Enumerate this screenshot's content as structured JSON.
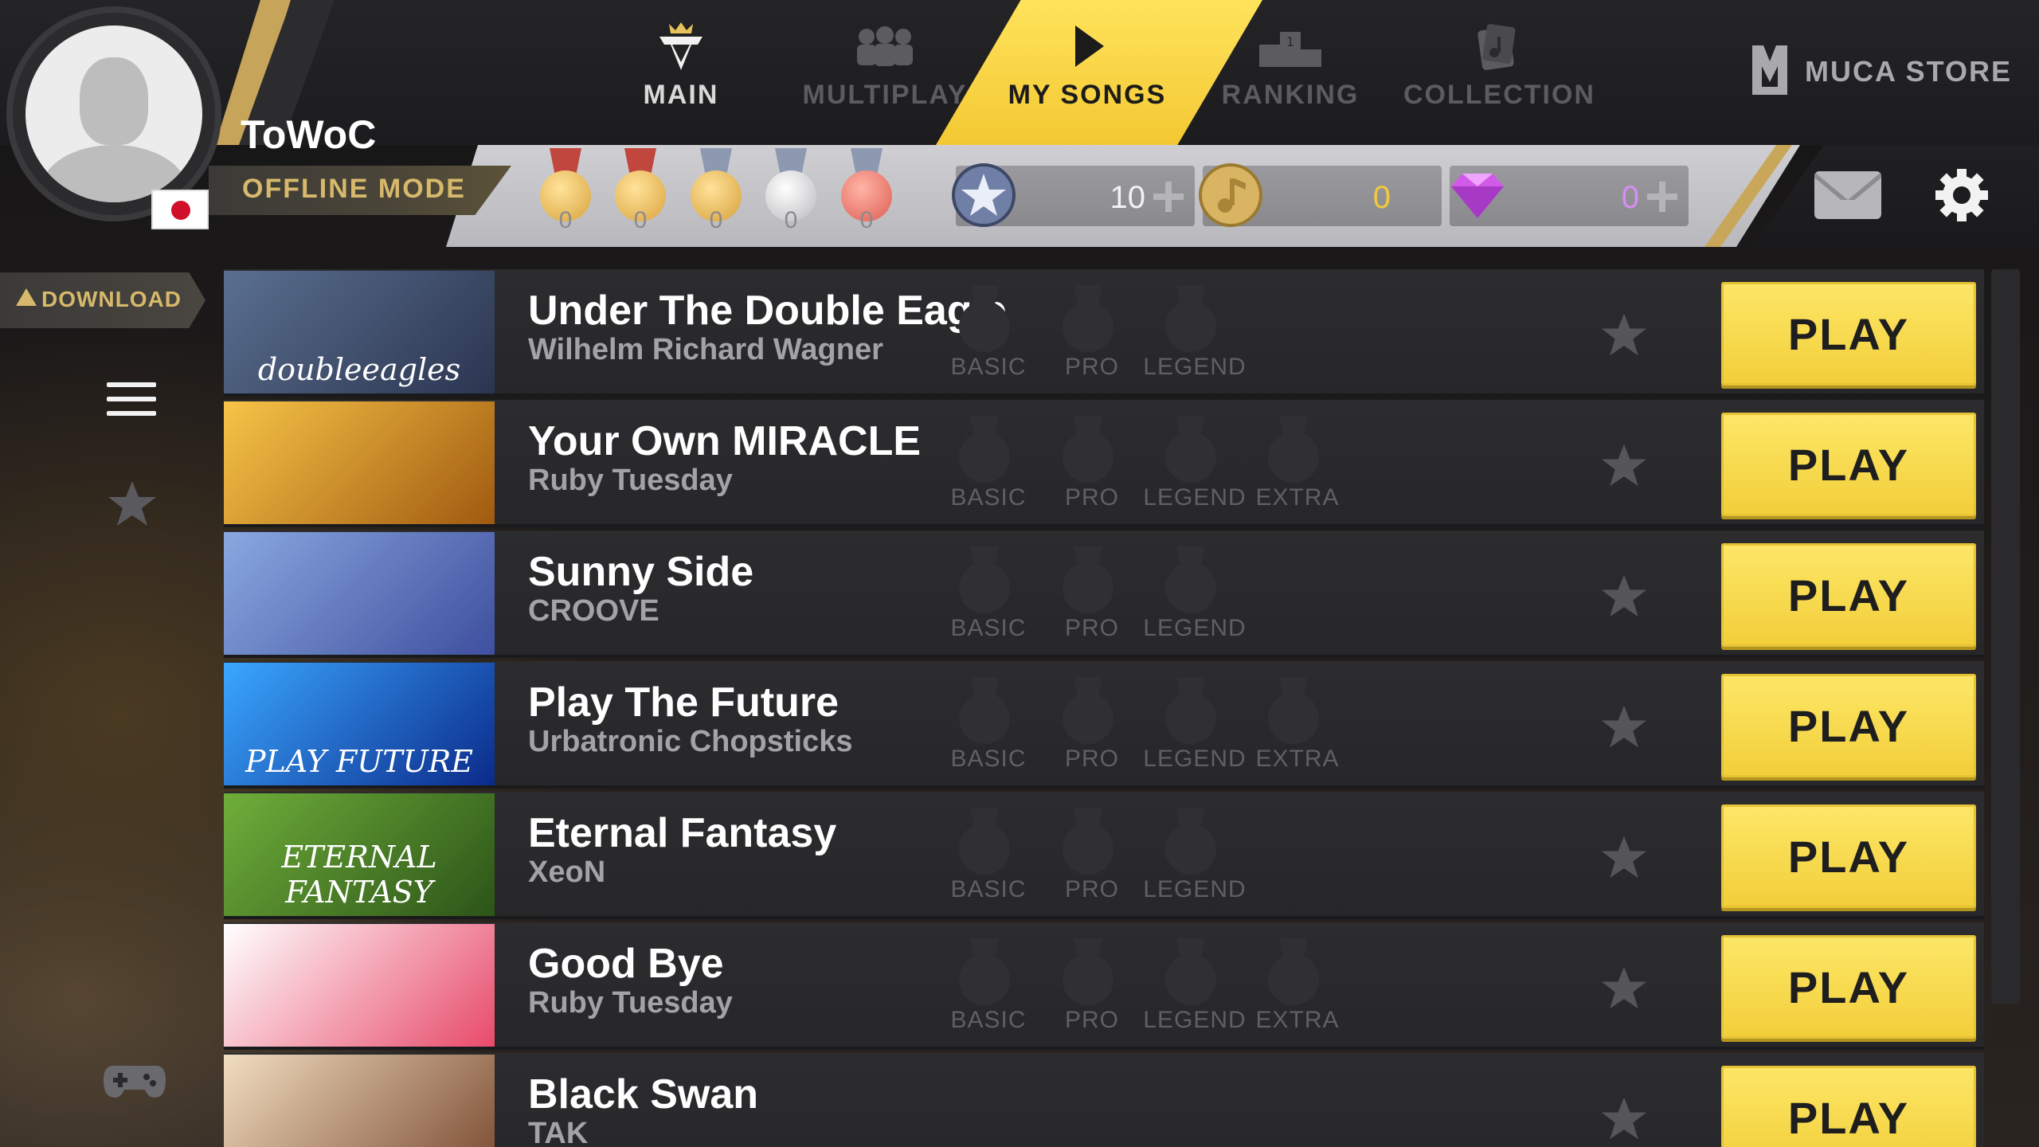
{
  "profile": {
    "username": "ToWoC",
    "mode": "OFFLINE MODE",
    "flag": "japan-flag"
  },
  "nav": [
    {
      "label": "MAIN",
      "icon": "crown-logo-icon",
      "state": "normal"
    },
    {
      "label": "MULTIPLAY",
      "icon": "group-icon",
      "state": "dim"
    },
    {
      "label": "MY SONGS",
      "icon": "play-icon",
      "state": "active"
    },
    {
      "label": "RANKING",
      "icon": "podium-icon",
      "state": "dim"
    },
    {
      "label": "COLLECTION",
      "icon": "music-card-icon",
      "state": "dim"
    }
  ],
  "store": {
    "label": "MUCA STORE",
    "icon": "muca-logo-icon"
  },
  "medals": [
    {
      "count": "0",
      "color": "#e8b24a"
    },
    {
      "count": "0",
      "color": "#e8b24a"
    },
    {
      "count": "0",
      "color": "#e0aa44"
    },
    {
      "count": "0",
      "color": "#cfcfd3"
    },
    {
      "count": "0",
      "color": "#e2736a"
    }
  ],
  "currencies": [
    {
      "name": "star",
      "icon": "star-coin-icon",
      "value": "10"
    },
    {
      "name": "music-coin",
      "icon": "note-coin-icon",
      "value": "0"
    },
    {
      "name": "gem",
      "icon": "diamond-icon",
      "value": "0"
    }
  ],
  "sidebar": {
    "download_label": "DOWNLOAD"
  },
  "play_label": "PLAY",
  "songs": [
    {
      "title": "Under The Double Eagle",
      "artist": "Wilhelm Richard Wagner",
      "difficulties": [
        "BASIC",
        "PRO",
        "LEGEND"
      ],
      "thumb_text": "doubleeagles",
      "thumb_colors": [
        "#5a6f8f",
        "#2b3550"
      ]
    },
    {
      "title": "Your Own MIRACLE",
      "artist": "Ruby Tuesday",
      "difficulties": [
        "BASIC",
        "PRO",
        "LEGEND",
        "EXTRA"
      ],
      "thumb_text": "",
      "thumb_colors": [
        "#f7c447",
        "#a05a10"
      ]
    },
    {
      "title": "Sunny Side",
      "artist": "CROOVE",
      "difficulties": [
        "BASIC",
        "PRO",
        "LEGEND"
      ],
      "thumb_text": "",
      "thumb_colors": [
        "#8aa8e0",
        "#3e4f9e"
      ]
    },
    {
      "title": "Play The Future",
      "artist": "Urbatronic Chopsticks",
      "difficulties": [
        "BASIC",
        "PRO",
        "LEGEND",
        "EXTRA"
      ],
      "thumb_text": "PLAY FUTURE",
      "thumb_colors": [
        "#3aa7ff",
        "#0b2a8a"
      ]
    },
    {
      "title": "Eternal Fantasy",
      "artist": "XeoN",
      "difficulties": [
        "BASIC",
        "PRO",
        "LEGEND"
      ],
      "thumb_text": "ETERNAL FANTASY",
      "thumb_colors": [
        "#6fae3a",
        "#2c5418"
      ]
    },
    {
      "title": "Good Bye",
      "artist": "Ruby Tuesday",
      "difficulties": [
        "BASIC",
        "PRO",
        "LEGEND",
        "EXTRA"
      ],
      "thumb_text": "",
      "thumb_colors": [
        "#ffffff",
        "#e84a6a"
      ]
    },
    {
      "title": "Black Swan",
      "artist": "TAK",
      "difficulties": [],
      "thumb_text": "",
      "thumb_colors": [
        "#f1ddc0",
        "#7a4a30"
      ]
    }
  ]
}
